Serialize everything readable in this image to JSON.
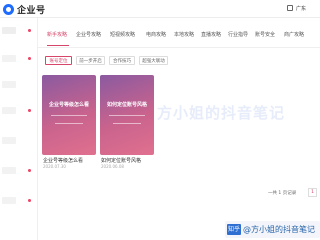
{
  "header": {
    "logo_text": "企业号",
    "region": "广东"
  },
  "tabs": [
    "新手攻略",
    "企业号攻略",
    "短视频攻略",
    "电商攻略",
    "本地攻略",
    "直播攻略",
    "行业指导",
    "账号安全",
    "商广攻略"
  ],
  "active_tab_index": 0,
  "subtabs": [
    "账号定位",
    "前一步开启",
    "合作技巧",
    "超强大联动"
  ],
  "active_subtab_index": 0,
  "cards": [
    {
      "title": "企业号等级怎么看",
      "caption": "企业号等级怎么看",
      "date": "2020.07.30"
    },
    {
      "title": "如何定位账号风格",
      "caption": "如何定位账号风格",
      "date": "2020.06.08"
    }
  ],
  "watermark": "方小姐的抖音笔记",
  "pagination": {
    "summary": "一共 1 页记录",
    "current_page": "1"
  },
  "credit": {
    "badge": "知乎",
    "text": "@方小姐的抖音笔记"
  },
  "colors": {
    "accent": "#d6456a",
    "brand": "#1e6bff"
  }
}
